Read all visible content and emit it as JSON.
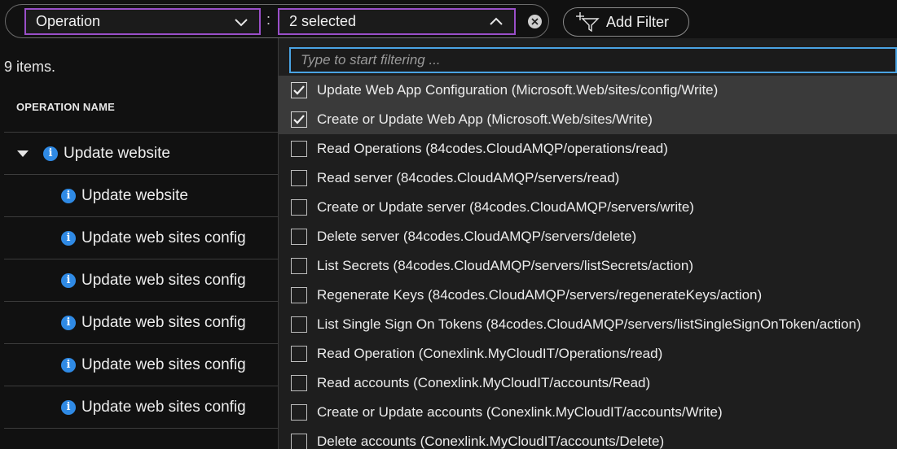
{
  "filter": {
    "field_label": "Operation",
    "separator": ":",
    "value_label": "2 selected",
    "add_filter_label": "Add Filter"
  },
  "list": {
    "count_text": "9 items.",
    "column_header": "OPERATION NAME",
    "rows": [
      {
        "label": "Update website",
        "expandable": true
      },
      {
        "label": "Update website"
      },
      {
        "label": "Update web sites config"
      },
      {
        "label": "Update web sites config"
      },
      {
        "label": "Update web sites config"
      },
      {
        "label": "Update web sites config"
      },
      {
        "label": "Update web sites config"
      }
    ]
  },
  "dropdown": {
    "search_placeholder": "Type to start filtering ...",
    "options": [
      {
        "label": "Update Web App Configuration (Microsoft.Web/sites/config/Write)",
        "checked": true
      },
      {
        "label": "Create or Update Web App (Microsoft.Web/sites/Write)",
        "checked": true
      },
      {
        "label": "Read Operations (84codes.CloudAMQP/operations/read)",
        "checked": false
      },
      {
        "label": "Read server (84codes.CloudAMQP/servers/read)",
        "checked": false
      },
      {
        "label": "Create or Update server (84codes.CloudAMQP/servers/write)",
        "checked": false
      },
      {
        "label": "Delete server (84codes.CloudAMQP/servers/delete)",
        "checked": false
      },
      {
        "label": "List Secrets (84codes.CloudAMQP/servers/listSecrets/action)",
        "checked": false
      },
      {
        "label": "Regenerate Keys (84codes.CloudAMQP/servers/regenerateKeys/action)",
        "checked": false
      },
      {
        "label": "List Single Sign On Tokens (84codes.CloudAMQP/servers/listSingleSignOnToken/action)",
        "checked": false
      },
      {
        "label": "Read Operation (Conexlink.MyCloudIT/Operations/read)",
        "checked": false
      },
      {
        "label": "Read accounts (Conexlink.MyCloudIT/accounts/Read)",
        "checked": false
      },
      {
        "label": "Create or Update accounts (Conexlink.MyCloudIT/accounts/Write)",
        "checked": false
      },
      {
        "label": "Delete accounts (Conexlink.MyCloudIT/accounts/Delete)",
        "checked": false
      }
    ]
  },
  "colors": {
    "accent_purple": "#9a4fc9",
    "focus_blue": "#4aa3e3",
    "info_blue": "#2f8ae5",
    "background": "#111111"
  },
  "icons": {
    "field_chevron": "chevron-down-icon",
    "value_chevron": "chevron-up-icon",
    "clear": "close-circle-icon",
    "add_filter": "add-filter-funnel-icon",
    "row_info": "info-icon",
    "row_expand": "caret-down-icon",
    "checkbox_check": "checkmark-icon"
  }
}
